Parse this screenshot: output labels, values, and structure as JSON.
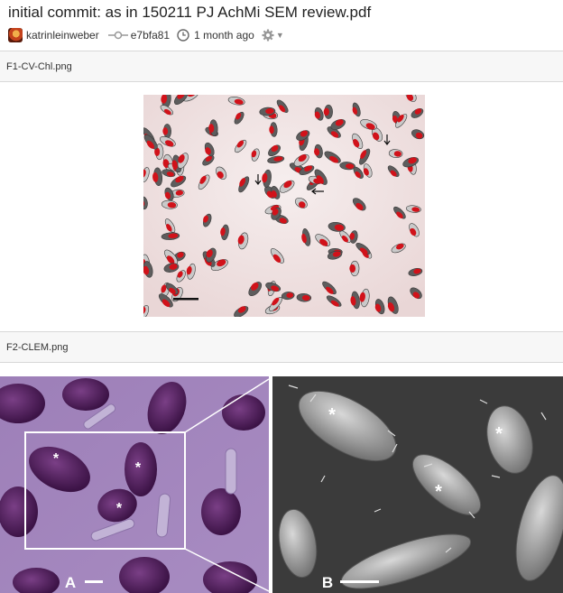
{
  "commit": {
    "title": "initial commit: as in 150211 PJ AchMi SEM review.pdf",
    "author": "katrinleinweber",
    "sha": "e7bfa81",
    "time_ago": "1 month ago",
    "icons": {
      "commit": "commit-icon",
      "clock": "clock-icon",
      "settings": "gear-icon",
      "menu": "caret-down-icon"
    }
  },
  "files": [
    {
      "name": "F1-CV-Chl.png"
    },
    {
      "name": "F2-CLEM.png"
    }
  ],
  "figure2": {
    "label_a": "A",
    "label_b": "B",
    "marker": "*"
  }
}
